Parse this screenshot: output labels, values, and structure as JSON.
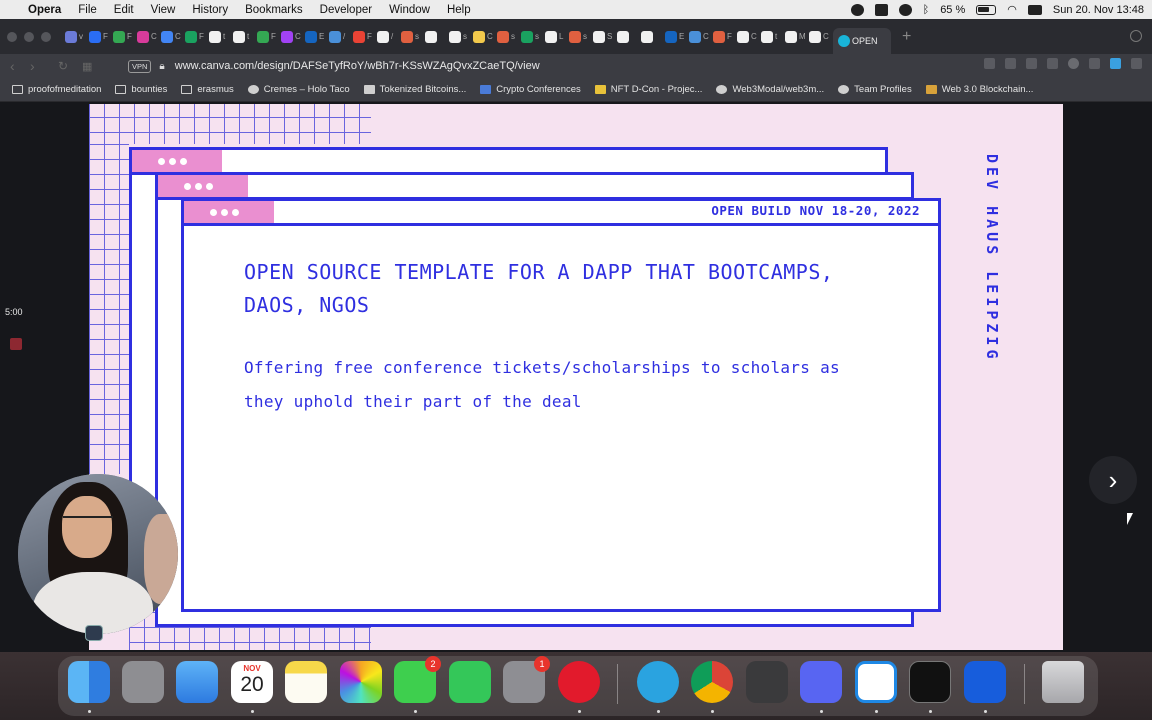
{
  "menubar": {
    "app": "Opera",
    "items": [
      "File",
      "Edit",
      "View",
      "History",
      "Bookmarks",
      "Developer",
      "Window",
      "Help"
    ],
    "battery": "65 %",
    "clock": "Sun 20. Nov  13:48"
  },
  "tabs": {
    "active_label": "OPEN",
    "favicon_colors": [
      "#6b7bd8",
      "#2a6df4",
      "#34a853",
      "#d83b9b",
      "#4285f4",
      "#1aa260",
      "#f1f1f1",
      "#f1f1f1",
      "#34a853",
      "#a142f4",
      "#1565c0",
      "#4a90d9",
      "#ea4335",
      "#f1f1f1",
      "#e06040",
      "#f1f1f1",
      "#f1f1f1",
      "#f2c94c",
      "#e06040",
      "#1aa260",
      "#f1f1f1",
      "#e06040",
      "#f1f1f1",
      "#f1f1f1",
      "#f1f1f1",
      "#1565c0",
      "#4a90d9",
      "#e06040",
      "#f1f1f1",
      "#f1f1f1",
      "#f1f1f1",
      "#f1f1f1"
    ],
    "tab_letters": [
      "v",
      "F",
      "F",
      "C",
      "C",
      "F",
      "t",
      "t",
      "F",
      "C",
      "E",
      "/",
      "F",
      "/",
      "s",
      "",
      "s",
      "C",
      "s",
      "s",
      "L",
      "s",
      "S",
      "",
      "",
      "E",
      "C",
      "F",
      "C",
      "t",
      "M",
      "C"
    ]
  },
  "address": {
    "vpn": "VPN",
    "url": "www.canva.com/design/DAFSeTyfRoY/wBh7r-KSsWZAgQvxZCaeTQ/view"
  },
  "bookmarks": [
    {
      "label": "proofofmeditation"
    },
    {
      "label": "bounties"
    },
    {
      "label": "erasmus"
    },
    {
      "label": "Cremes – Holo Taco"
    },
    {
      "label": "Tokenized Bitcoins..."
    },
    {
      "label": "Crypto Conferences"
    },
    {
      "label": "NFT D-Con - Projec..."
    },
    {
      "label": "Web3Modal/web3m..."
    },
    {
      "label": "Team Profiles"
    },
    {
      "label": "Web 3.0 Blockchain..."
    }
  ],
  "slide": {
    "event": "OPEN BUILD  NOV 18-20, 2022",
    "title": "OPEN SOURCE TEMPLATE FOR A DAPP THAT BOOTCAMPS, DAOS, NGOS",
    "body": "Offering free conference tickets/scholarships to scholars as they uphold their part of the deal",
    "vertical": "DEV HAUS LEIPZIG",
    "colors": {
      "accent": "#2f2fe0",
      "pink": "#ea8fd0",
      "bg": "#f6e2f0"
    }
  },
  "overlay": {
    "timer": "5:00",
    "next_icon": "chevron-right-icon"
  },
  "dock": {
    "calendar_month": "NOV",
    "calendar_day": "20",
    "messages_badge": "2",
    "settings_badge": "1"
  }
}
